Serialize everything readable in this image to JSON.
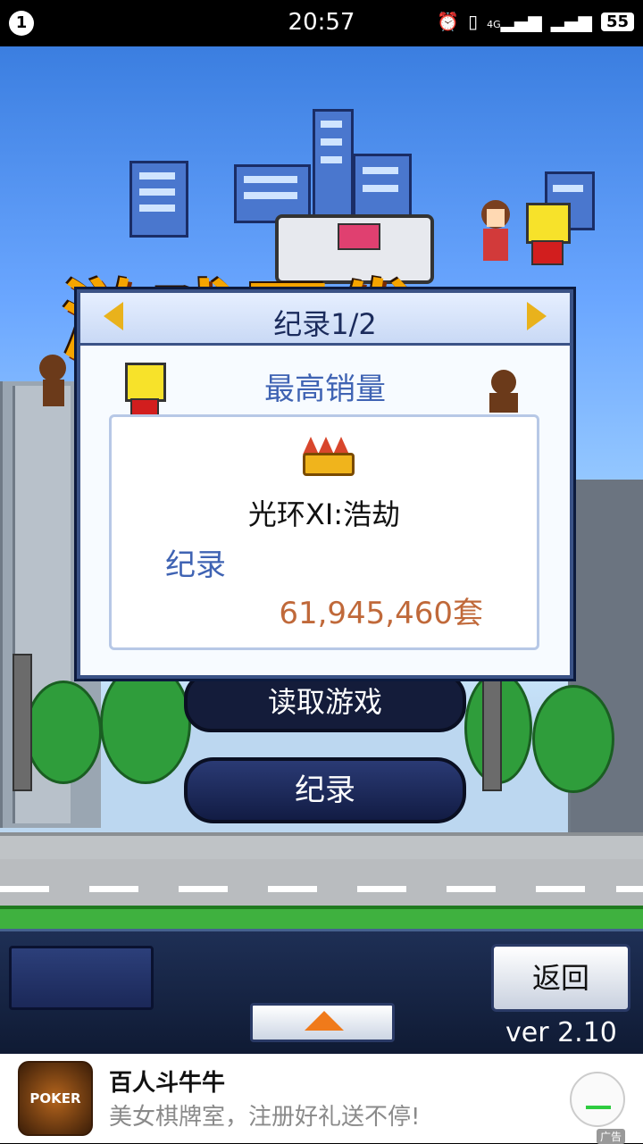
{
  "status_bar": {
    "notification_count": "1",
    "time": "20:57",
    "network": "4G",
    "battery": "55",
    "icons": [
      "alarm-icon",
      "vibrate-icon",
      "signal-4g-icon",
      "signal-icon"
    ]
  },
  "game": {
    "logo_text": "游戏开发",
    "menu_hidden_label": "读取游戏",
    "menu_record_label": "纪录",
    "back_label": "返回",
    "version": "ver 2.10"
  },
  "dialog": {
    "title": "纪录1/2",
    "subtitle": "最高销量",
    "game_name": "光环XI:浩劫",
    "record_label": "纪录",
    "record_value": "61,945,460套"
  },
  "ad": {
    "icon_text": "POKER",
    "title": "百人斗牛牛",
    "description": "美女棋牌室，注册好礼送不停!",
    "tag": "广告"
  },
  "colors": {
    "accent_orange": "#f07a1a",
    "record_value": "#c0693a",
    "label_blue": "#3f63b3",
    "dialog_border": "#3a5286"
  }
}
